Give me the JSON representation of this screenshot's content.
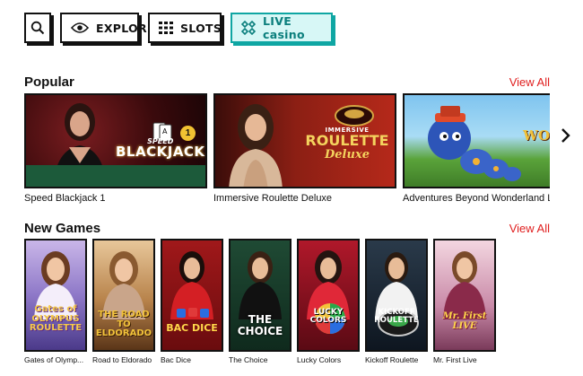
{
  "nav": {
    "search_icon": "search-icon",
    "explore_label": "EXPLORE",
    "slots_label": "SLOTS",
    "live_casino_label": "LIVE casino"
  },
  "popular": {
    "title": "Popular",
    "view_all": "View All",
    "games": [
      {
        "title": "Speed Blackjack 1",
        "logo_top": "SPEED",
        "logo_main": "BLACKJACK"
      },
      {
        "title": "Immersive Roulette Deluxe",
        "logo_top": "IMMERSIVE",
        "logo_main": "ROULETTE",
        "logo_sub": "Deluxe"
      },
      {
        "title": "Adventures Beyond Wonderland L",
        "logo_main": "WONDER"
      }
    ]
  },
  "new_games": {
    "title": "New Games",
    "view_all": "View All",
    "games": [
      {
        "title": "Gates of Olymp...",
        "logo": "Gates of OLYMPUS ROULETTE"
      },
      {
        "title": "Road to Eldorado",
        "logo": "THE ROAD TO ELDORADO"
      },
      {
        "title": "Bac Dice",
        "logo": "BAC DICE"
      },
      {
        "title": "The Choice",
        "logo": "THE CHOICE"
      },
      {
        "title": "Lucky Colors",
        "logo": "LUCKY COLORS"
      },
      {
        "title": "Kickoff Roulette",
        "logo": "KICKOFF ROULETTE"
      },
      {
        "title": "Mr. First Live",
        "logo": "Mr. First LIVE"
      }
    ]
  }
}
